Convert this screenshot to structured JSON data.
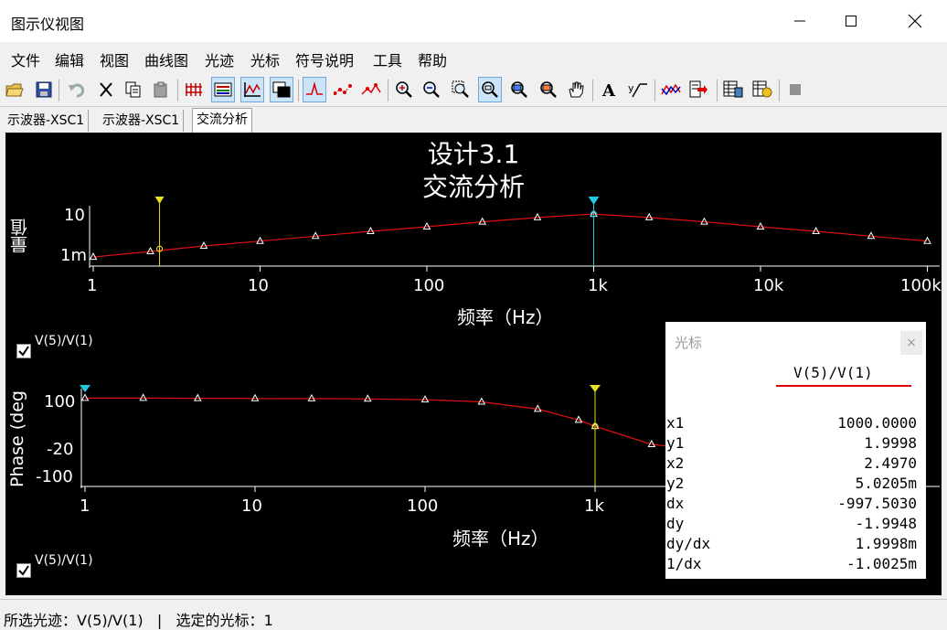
{
  "window": {
    "title": "图示仪视图"
  },
  "menu": {
    "items": [
      "文件",
      "编辑",
      "视图",
      "曲线图",
      "光迹",
      "光标",
      "符号说明",
      "工具",
      "帮助"
    ]
  },
  "toolbar": {
    "buttons": [
      "open-icon",
      "save-icon",
      "undo-icon",
      "cut-icon",
      "copy-icon",
      "paste-icon",
      "grid-icon",
      "legend-icon",
      "graph-icon",
      "overlay-icon",
      "trace-icon",
      "dots-icon",
      "cursors-icon",
      "zoom-in-icon",
      "zoom-out-icon",
      "zoom-fit-icon",
      "zoom-x-icon",
      "zoom-y-icon",
      "zoom-full-icon",
      "pan-icon",
      "text-icon",
      "label-icon",
      "reverse-icon",
      "export-icon",
      "data-icon",
      "transfer-icon",
      "stop-icon"
    ]
  },
  "tabs": [
    {
      "label": "示波器-XSC1"
    },
    {
      "label": "示波器-XSC1"
    },
    {
      "label": "交流分析"
    }
  ],
  "chart": {
    "title_line1": "设计3.1",
    "title_line2": "交流分析",
    "colors": {
      "trace": "#e01010",
      "cursor1": "#22c8e0",
      "cursor2": "#e8e020",
      "background": "#000000"
    }
  },
  "chart_data": [
    {
      "type": "line",
      "x_scale": "log",
      "xlim": [
        1,
        100000
      ],
      "ylabel": "量值",
      "xlabel": "频率（Hz）",
      "xticks": [
        "1",
        "10",
        "100",
        "1k",
        "10k",
        "100k"
      ],
      "yticks": [
        "10",
        "1m"
      ],
      "series": [
        {
          "name": "V(5)/V(1)",
          "x": [
            1,
            2.2,
            4.6,
            10,
            21.5,
            46,
            100,
            215,
            460,
            1000,
            2150,
            4600,
            10000,
            21500,
            46000,
            100000
          ],
          "y": [
            0.0008,
            0.0028,
            0.0095,
            0.028,
            0.085,
            0.25,
            0.7,
            2.1,
            5.5,
            12,
            5.5,
            2.1,
            0.7,
            0.25,
            0.085,
            0.028
          ]
        }
      ]
    },
    {
      "type": "line",
      "x_scale": "log",
      "xlim": [
        1,
        100000
      ],
      "ylabel": "Phase (deg",
      "xlabel": "频率（Hz）",
      "xticks": [
        "1",
        "10",
        "100",
        "1k"
      ],
      "yticks": [
        "100",
        "-20",
        "-100"
      ],
      "series": [
        {
          "name": "V(5)/V(1)",
          "x": [
            1,
            2.2,
            4.6,
            10,
            21.5,
            46,
            100,
            215,
            460,
            800,
            1000,
            2150,
            4600,
            10000
          ],
          "y": [
            90,
            90,
            89.5,
            89,
            88.5,
            87.5,
            85,
            78,
            55,
            20,
            0,
            -58,
            -78,
            -85
          ]
        }
      ]
    }
  ],
  "legend": {
    "label": "V(5)/V(1)"
  },
  "cursor_panel": {
    "title": "光标",
    "close": "×",
    "series": "V(5)/V(1)",
    "rows": [
      {
        "key": "x1",
        "val": "1000.0000"
      },
      {
        "key": "y1",
        "val": "1.9998"
      },
      {
        "key": "x2",
        "val": "2.4970"
      },
      {
        "key": "y2",
        "val": "5.0205m"
      },
      {
        "key": "dx",
        "val": "-997.5030"
      },
      {
        "key": "dy",
        "val": "-1.9948"
      },
      {
        "key": "dy/dx",
        "val": "1.9998m"
      },
      {
        "key": "1/dx",
        "val": "-1.0025m"
      }
    ]
  },
  "status": {
    "trace_label": "所选光迹：",
    "trace": "V(5)/V(1)",
    "sep": "|",
    "cursor_label": "选定的光标：",
    "cursor": "1"
  }
}
